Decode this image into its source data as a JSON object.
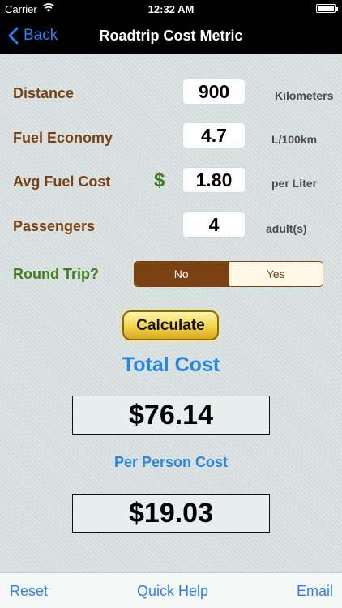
{
  "status": {
    "carrier": "Carrier",
    "time": "12:32 AM"
  },
  "nav": {
    "back_label": "Back",
    "title": "Roadtrip Cost Metric"
  },
  "form": {
    "distance": {
      "label": "Distance",
      "value": "900",
      "unit": "Kilometers"
    },
    "fuel_economy": {
      "label": "Fuel Economy",
      "value": "4.7",
      "unit": "L/100km"
    },
    "fuel_cost": {
      "label": "Avg Fuel Cost",
      "currency": "$",
      "value": "1.80",
      "unit": "per Liter"
    },
    "passengers": {
      "label": "Passengers",
      "value": "4",
      "unit": "adult(s)"
    },
    "round_trip": {
      "label": "Round Trip?",
      "options": [
        "No",
        "Yes"
      ],
      "selected": "No"
    }
  },
  "calculate_label": "Calculate",
  "results": {
    "total_title": "Total Cost",
    "total_value": "$76.14",
    "per_person_title": "Per Person Cost",
    "per_person_value": "$19.03"
  },
  "toolbar": {
    "reset": "Reset",
    "quick_help": "Quick Help",
    "email": "Email"
  },
  "colors": {
    "label_brown": "#7a4212",
    "label_green": "#3f7d1e",
    "accent_blue": "#2a85e0",
    "ios_blue": "#2a7ff2"
  }
}
